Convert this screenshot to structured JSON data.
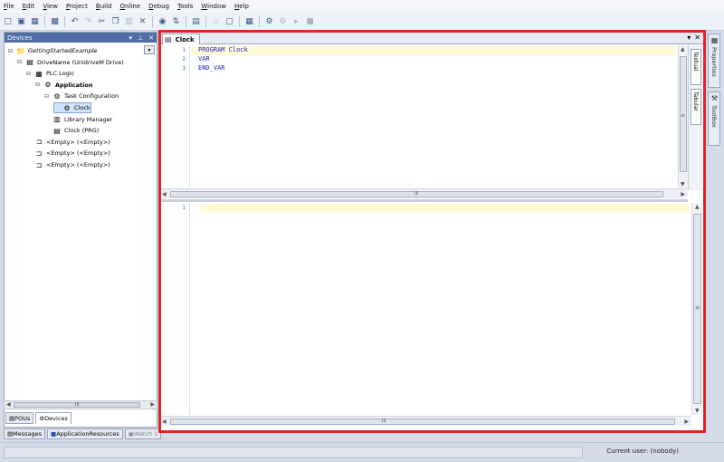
{
  "menu": [
    {
      "label": "File",
      "u": "F"
    },
    {
      "label": "Edit",
      "u": "E"
    },
    {
      "label": "View",
      "u": "V"
    },
    {
      "label": "Project",
      "u": "P"
    },
    {
      "label": "Build",
      "u": "B"
    },
    {
      "label": "Online",
      "u": "O"
    },
    {
      "label": "Debug",
      "u": "D"
    },
    {
      "label": "Tools",
      "u": "T"
    },
    {
      "label": "Window",
      "u": "W"
    },
    {
      "label": "Help",
      "u": "H"
    }
  ],
  "devices_panel": {
    "title": "Devices",
    "pin": "−̂",
    "close": "✕",
    "tree": [
      {
        "label": "GettingStartedExample",
        "icon": "project-icon",
        "glyph": "📁",
        "indent": 0,
        "exp": "⊟",
        "style": "ital"
      },
      {
        "label": "DriveName (UnidriveM Drive)",
        "icon": "drive-icon",
        "glyph": "▤",
        "indent": 1,
        "exp": "⊟",
        "style": ""
      },
      {
        "label": "PLC Logic",
        "icon": "plc-logic-icon",
        "glyph": "▦",
        "indent": 2,
        "exp": "⊟",
        "style": ""
      },
      {
        "label": "Application",
        "icon": "application-icon",
        "glyph": "⚙",
        "indent": 3,
        "exp": "⊟",
        "style": "bold"
      },
      {
        "label": "Task Configuration",
        "icon": "task-config-icon",
        "glyph": "⚙",
        "indent": 4,
        "exp": "⊟",
        "style": ""
      },
      {
        "label": "Clock",
        "icon": "task-icon",
        "glyph": "⚙",
        "indent": 5,
        "exp": "",
        "style": "sel"
      },
      {
        "label": "Library Manager",
        "icon": "library-icon",
        "glyph": "▥",
        "indent": 4,
        "exp": "",
        "style": ""
      },
      {
        "label": "Clock (PRG)",
        "icon": "program-icon",
        "glyph": "▤",
        "indent": 4,
        "exp": "",
        "style": ""
      },
      {
        "label": "<Empty> (<Empty>)",
        "icon": "empty-slot-icon",
        "glyph": "⊐",
        "indent": 2,
        "exp": "",
        "style": ""
      },
      {
        "label": "<Empty> (<Empty>)",
        "icon": "empty-slot-icon",
        "glyph": "⊐",
        "indent": 2,
        "exp": "",
        "style": ""
      },
      {
        "label": "<Empty> (<Empty>)",
        "icon": "empty-slot-icon",
        "glyph": "⊐",
        "indent": 2,
        "exp": "",
        "style": ""
      }
    ],
    "scroll_mark": "III"
  },
  "pane_tabs": [
    {
      "label": "POUs",
      "icon": "pous-icon",
      "active": false
    },
    {
      "label": "Devices",
      "icon": "devices-icon",
      "active": true
    }
  ],
  "message_tabs": [
    {
      "label": "Messages",
      "icon": "messages-icon"
    },
    {
      "label": "ApplicationResources",
      "icon": "app-resources-icon"
    },
    {
      "label": "Watch 1",
      "icon": "watch-icon"
    }
  ],
  "editor": {
    "tab_label": "Clock",
    "ctrl_dropdown": "▾",
    "ctrl_close": "✕",
    "decl_lines": [
      {
        "num": "1",
        "text": "PROGRAM Clock"
      },
      {
        "num": "2",
        "text": "VAR"
      },
      {
        "num": "3",
        "text": "END_VAR"
      }
    ],
    "body_lines": [
      {
        "num": "1",
        "text": ""
      }
    ],
    "scroll_mark": "III",
    "side_tabs": [
      {
        "label": "Textual",
        "icon": "textual-icon"
      },
      {
        "label": "Tabular",
        "icon": "tabular-icon"
      }
    ]
  },
  "right_dock": [
    {
      "label": "Properties",
      "icon": "properties-icon"
    },
    {
      "label": "ToolBox",
      "icon": "toolbox-icon"
    }
  ],
  "status": {
    "user": "Current user: (nobody)"
  },
  "colors": {
    "highlight_frame": "#e0242a",
    "keyword": "#1c1cb5",
    "panel_header": "#4f6ea7"
  }
}
